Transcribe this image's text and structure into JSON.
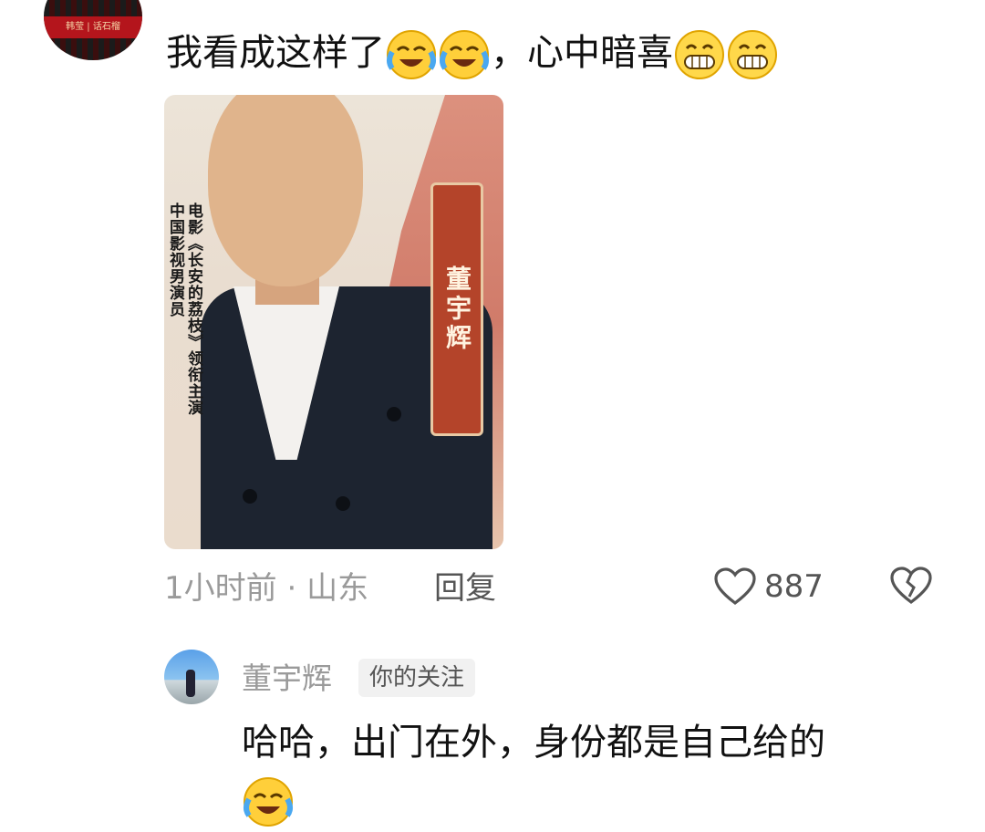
{
  "comment": {
    "avatar_text": "韩莹 | 话石榴",
    "text": "我看成这样了",
    "text_after": "，心中暗喜",
    "emojis": [
      "laugh-cry-emoji",
      "laugh-cry-emoji",
      "grin-emoji",
      "grin-emoji"
    ],
    "image": {
      "left_caption_1": "电影《长安的荔枝》领衔主演",
      "left_caption_2": "中国影视男演员",
      "name_tag": "董宇辉"
    },
    "time": "1小时前",
    "separator": "·",
    "location": "山东",
    "reply_label": "回复",
    "like_count": "887"
  },
  "reply": {
    "name": "董宇辉",
    "badge": "你的关注",
    "text": "哈哈，出门在外，身份都是自己给的"
  },
  "colors": {
    "muted": "#9a9a9a",
    "badge_bg": "#f1f1f1",
    "name_tag_bg": "#b4442a"
  }
}
